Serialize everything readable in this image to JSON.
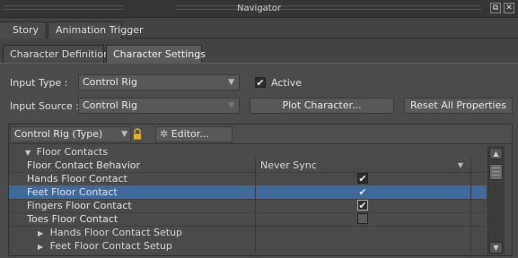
{
  "window": {
    "title": "Navigator",
    "float_btn": "⧉",
    "close_btn": "✕"
  },
  "top_tabs": [
    {
      "label": "Story"
    },
    {
      "label": "Animation Trigger"
    }
  ],
  "sub_tabs": [
    {
      "label": "Character Definition",
      "active": false
    },
    {
      "label": "Character Settings",
      "active": true
    }
  ],
  "form": {
    "input_type_label": "Input Type :",
    "input_type_value": "Control Rig",
    "active_label": "Active",
    "active_checked": true,
    "input_source_label": "Input Source :",
    "input_source_value": "Control Rig",
    "plot_button": "Plot Character...",
    "reset_button": "Reset All Properties"
  },
  "toolbar": {
    "type_combo": "Control Rig (Type)",
    "editor_button": "Editor..."
  },
  "properties": {
    "group": "Floor Contacts",
    "rows": [
      {
        "name": "Floor Contact Behavior",
        "value": "Never Sync"
      },
      {
        "name": "Hands Floor Contact",
        "checked": true
      },
      {
        "name": "Feet Floor Contact",
        "checked": true,
        "selected": true
      },
      {
        "name": "Fingers Floor Contact",
        "checked": true
      },
      {
        "name": "Toes Floor Contact",
        "checked": false
      }
    ],
    "subgroups": [
      "Hands Floor Contact Setup",
      "Feet Floor Contact Setup"
    ]
  },
  "colors": {
    "selection": "#3e6a9c",
    "panel_bg": "#4b4b4b"
  }
}
